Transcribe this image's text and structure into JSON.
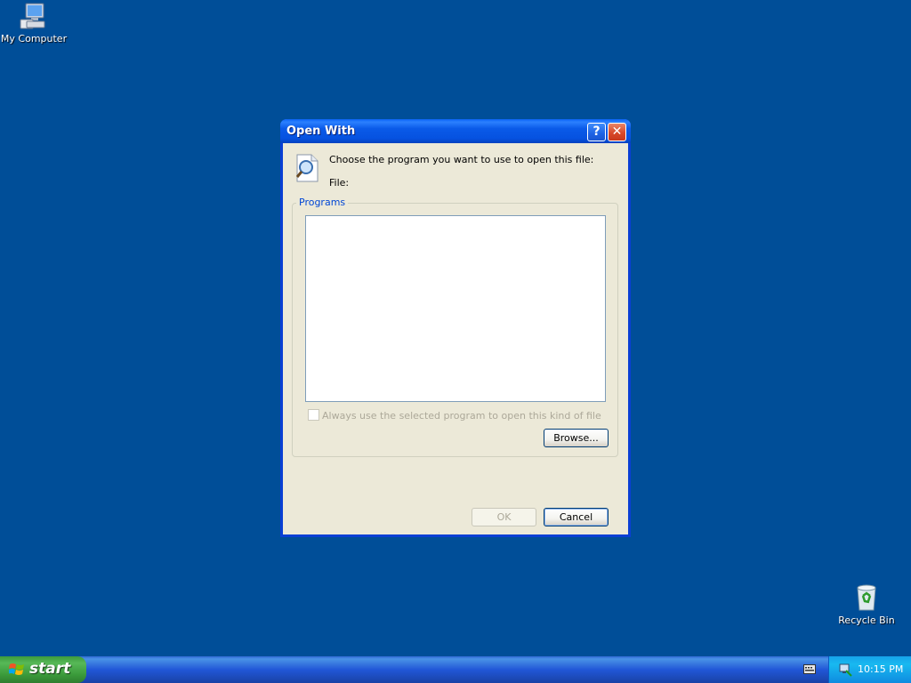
{
  "desktop": {
    "icons": [
      {
        "label": "My Computer"
      },
      {
        "label": "Recycle Bin"
      }
    ]
  },
  "dialog": {
    "title": "Open With",
    "help_glyph": "?",
    "close_glyph": "✕",
    "prompt": "Choose the program you want to use to open this file:",
    "file_label": "File:",
    "programs_group": "Programs",
    "always_use_label": "Always use the selected program to open this kind of file",
    "always_use_checked": false,
    "browse_label": "Browse...",
    "ok_label": "OK",
    "cancel_label": "Cancel"
  },
  "taskbar": {
    "start_label": "start",
    "clock": "10:15 PM"
  },
  "colors": {
    "desktop": "#004e98",
    "title_blue": "#0a5ae8",
    "dialog_face": "#ece9d8",
    "group_title": "#0046d5"
  }
}
